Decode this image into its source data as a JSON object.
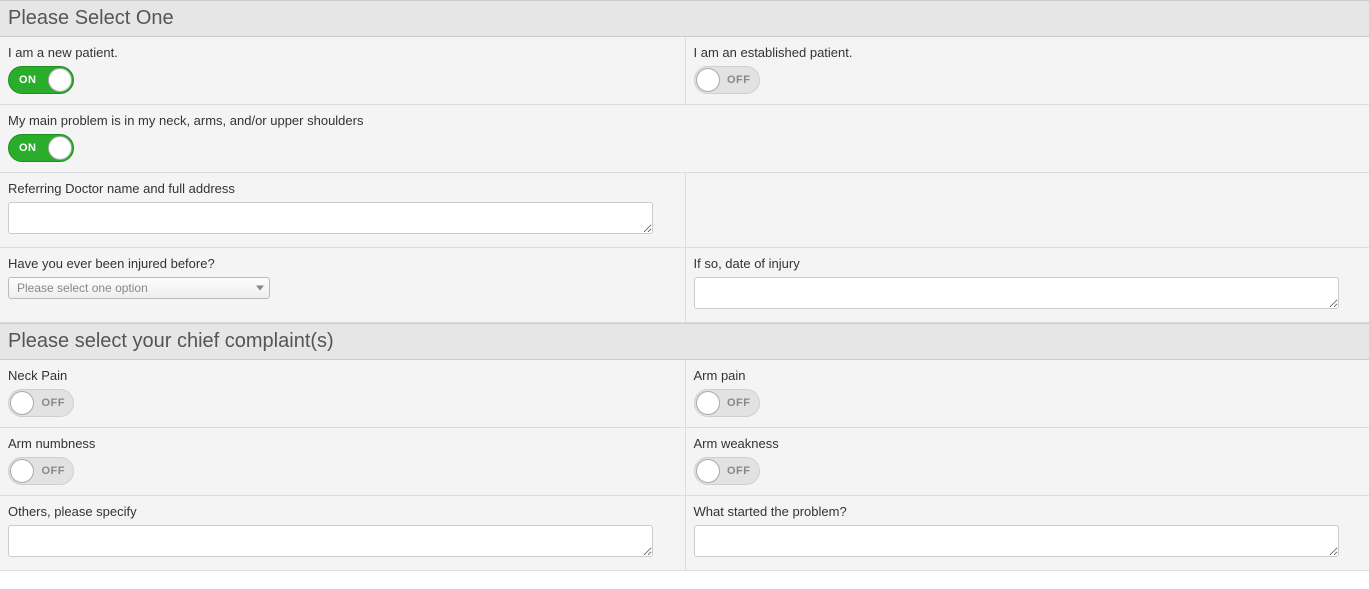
{
  "section1": {
    "title": "Please Select One",
    "fields": {
      "new_patient": {
        "label": "I am a new patient.",
        "state": "on",
        "onText": "ON",
        "offText": "OFF"
      },
      "est_patient": {
        "label": "I am an established patient.",
        "state": "off",
        "onText": "ON",
        "offText": "OFF"
      },
      "neck_problem": {
        "label": "My main problem is in my neck, arms, and/or upper shoulders",
        "state": "on",
        "onText": "ON",
        "offText": "OFF"
      },
      "ref_doctor": {
        "label": "Referring Doctor name and full address",
        "value": ""
      },
      "injured": {
        "label": "Have you ever been injured before?",
        "placeholder": "Please select one option"
      },
      "injury_date": {
        "label": "If so, date of injury",
        "value": ""
      }
    }
  },
  "section2": {
    "title": "Please select your chief complaint(s)",
    "fields": {
      "neck_pain": {
        "label": "Neck Pain",
        "state": "off",
        "onText": "ON",
        "offText": "OFF"
      },
      "arm_pain": {
        "label": "Arm pain",
        "state": "off",
        "onText": "ON",
        "offText": "OFF"
      },
      "arm_numb": {
        "label": "Arm numbness",
        "state": "off",
        "onText": "ON",
        "offText": "OFF"
      },
      "arm_weak": {
        "label": "Arm weakness",
        "state": "off",
        "onText": "ON",
        "offText": "OFF"
      },
      "others": {
        "label": "Others, please specify",
        "value": ""
      },
      "started": {
        "label": "What started the problem?",
        "value": ""
      }
    }
  }
}
